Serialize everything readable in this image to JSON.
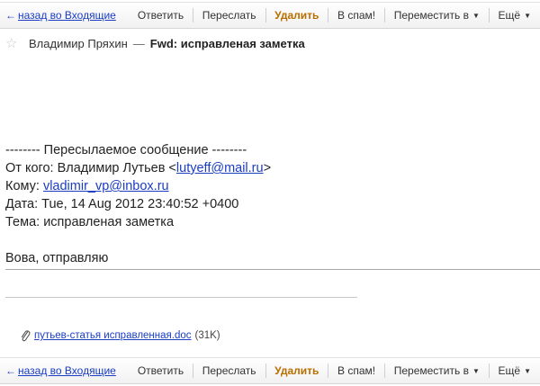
{
  "toolbar": {
    "back": "назад во Входящие",
    "reply": "Ответить",
    "forward": "Переслать",
    "delete": "Удалить",
    "spam": "В спам!",
    "move": "Переместить в",
    "more": "Ещё"
  },
  "message": {
    "sender": "Владимир Пряхин",
    "dash": "—",
    "subject": "Fwd: исправленая заметка",
    "forward_header": "-------- Пересылаемое сообщение --------",
    "from_prefix": "От кого: Владимир Лутьев <",
    "from_email": "lutyeff@mail.ru",
    "from_suffix": ">",
    "to_prefix": "Кому: ",
    "to_email": "vladimir_vp@inbox.ru",
    "date_line": "Дата: Tue, 14 Aug 2012 23:40:52 +0400",
    "subject_line": "Тема: исправленая заметка",
    "text": "Вова, отправляю"
  },
  "attachment": {
    "filename": "путьев-статья исправленная.doc",
    "size": "(31K)"
  },
  "icons": {
    "back": "back-arrow-icon",
    "star": "star-icon",
    "caret": "chevron-down-icon",
    "clip": "paperclip-icon"
  }
}
